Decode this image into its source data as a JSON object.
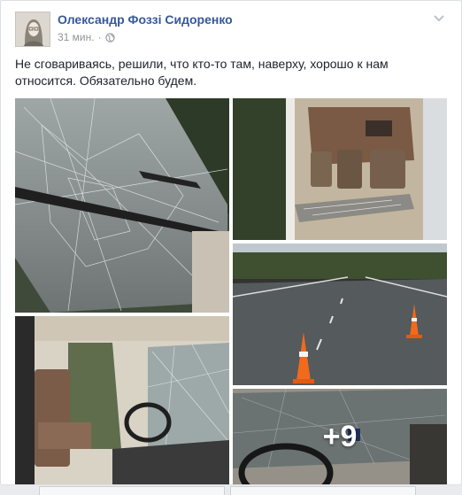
{
  "post": {
    "author": "Олександр Фоззі Сидоренко",
    "time": "31 мин.",
    "separator": "·",
    "privacy_icon": "globe-icon",
    "options_icon": "chevron-down-icon",
    "text": "Не сговариваясь, решили, что кто-то там, наверху, хорошо к нам относится. Обязательно будем.",
    "photos_more": "+9"
  },
  "colors": {
    "author_link": "#365899",
    "meta": "#90949c",
    "body_text": "#1d2129",
    "page_bg": "#e9ebee"
  }
}
